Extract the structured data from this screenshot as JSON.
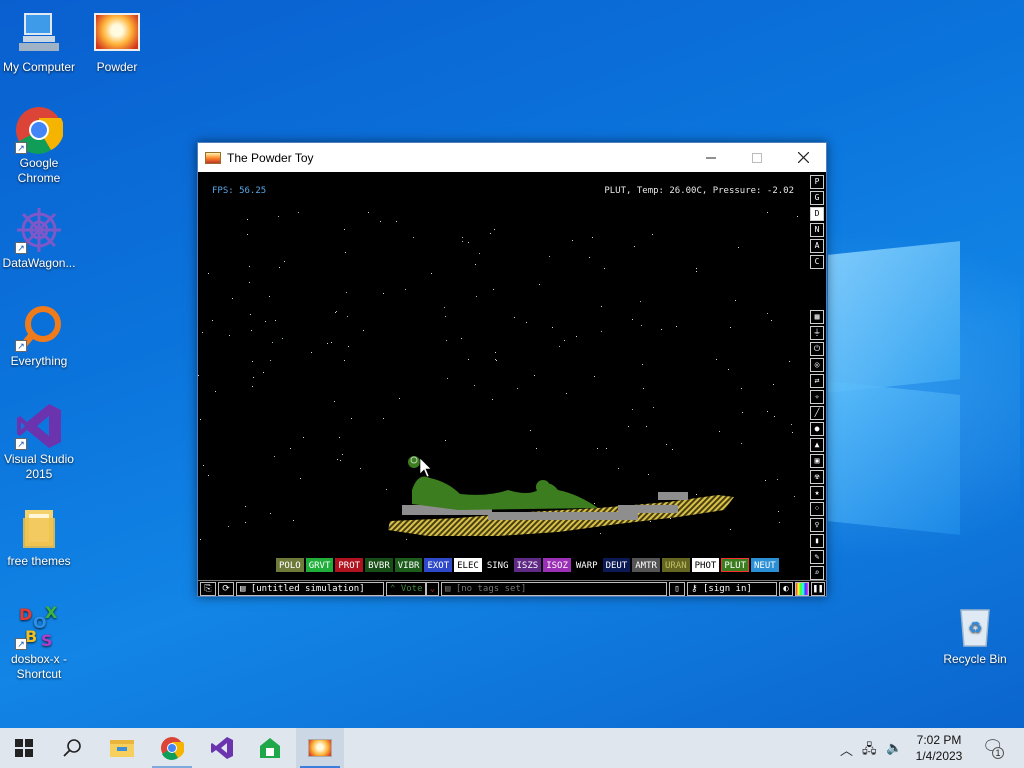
{
  "desktop": {
    "icons": [
      {
        "label": "My Computer",
        "icon": "computer-icon"
      },
      {
        "label": "Powder",
        "icon": "powder-toy-icon"
      },
      {
        "label": "Google Chrome",
        "icon": "chrome-icon"
      },
      {
        "label": "DataWagon...",
        "icon": "datawagon-icon"
      },
      {
        "label": "Everything",
        "icon": "everything-search-icon"
      },
      {
        "label": "Visual Studio 2015",
        "icon": "visual-studio-icon"
      },
      {
        "label": "free themes",
        "icon": "folder-icon"
      },
      {
        "label": "dosbox-x - Shortcut",
        "icon": "dosbox-icon"
      },
      {
        "label": "Recycle Bin",
        "icon": "recycle-bin-icon"
      }
    ]
  },
  "window": {
    "title": "The Powder Toy",
    "fps": "FPS: 56.25",
    "status": "PLUT, Temp: 26.00C, Pressure: -2.02",
    "right_buttons_top": [
      "P",
      "G",
      "D",
      "N",
      "A",
      "C"
    ],
    "right_selected": "D",
    "elements": [
      {
        "label": "POLO",
        "color": "#6e7a3a"
      },
      {
        "label": "GRVT",
        "color": "#1fae3a"
      },
      {
        "label": "PROT",
        "color": "#b0121f"
      },
      {
        "label": "BVBR",
        "color": "#174d17"
      },
      {
        "label": "VIBR",
        "color": "#1c5d1c"
      },
      {
        "label": "EXOT",
        "color": "#2d48c8"
      },
      {
        "label": "ELEC",
        "color": "#ffffff"
      },
      {
        "label": "SING",
        "color": "#000000"
      },
      {
        "label": "ISZS",
        "color": "#5f2a86"
      },
      {
        "label": "ISOZ",
        "color": "#9b2fb5"
      },
      {
        "label": "WARP",
        "color": "#000000"
      },
      {
        "label": "DEUT",
        "color": "#0b1a54"
      },
      {
        "label": "AMTR",
        "color": "#555555"
      },
      {
        "label": "URAN",
        "color": "#666623"
      },
      {
        "label": "PHOT",
        "color": "#ffffff"
      },
      {
        "label": "PLUT",
        "color": "#3c7d1f"
      },
      {
        "label": "NEUT",
        "color": "#2b8fd6"
      }
    ],
    "selected_element": "PLUT",
    "bottom": {
      "save_name": "[untitled simulation]",
      "vote": "Vote",
      "tags": "[no tags set]",
      "sign_in": "[sign in]"
    }
  },
  "taskbar": {
    "time": "7:02 PM",
    "date": "1/4/2023",
    "notifications": "1",
    "apps": [
      "start-icon",
      "search-icon",
      "file-explorer-icon",
      "chrome-icon",
      "visual-studio-icon",
      "app-icon",
      "powder-toy-icon"
    ]
  }
}
